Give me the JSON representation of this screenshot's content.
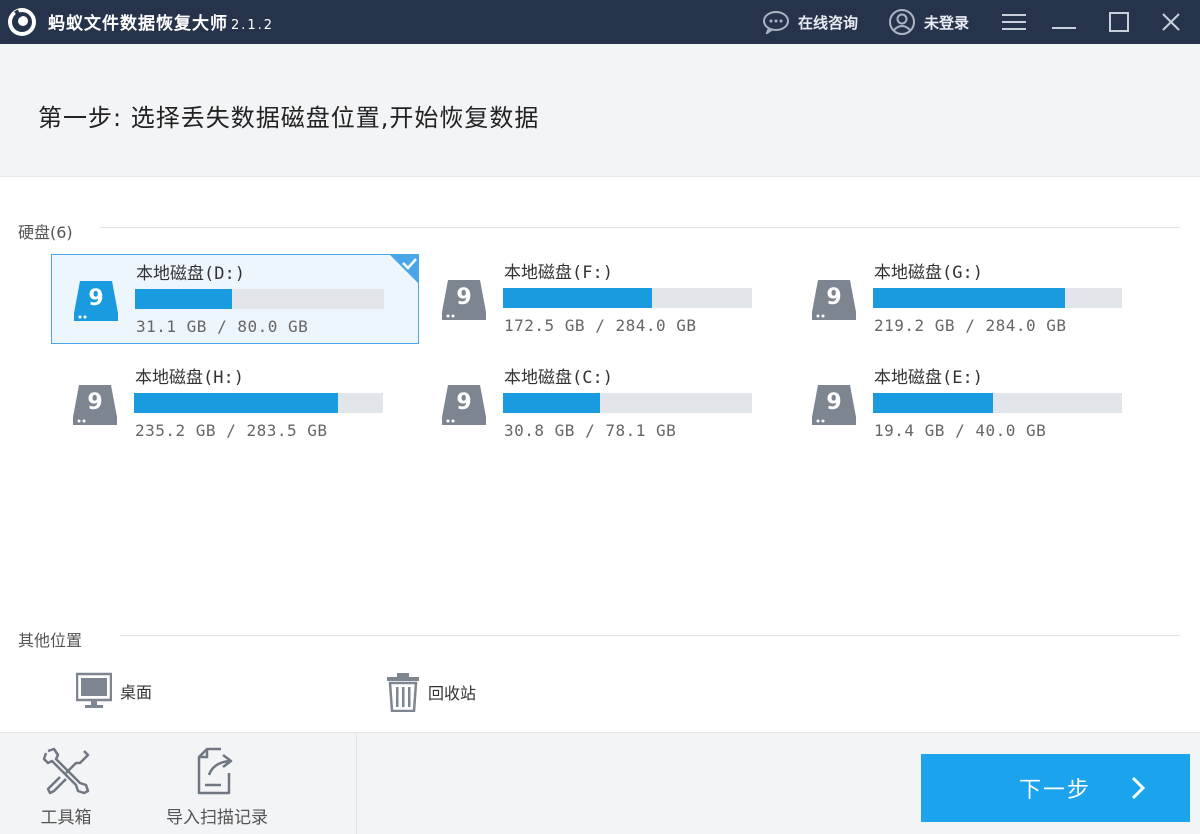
{
  "app": {
    "title": "蚂蚁文件数据恢复大师",
    "version": "2.1.2",
    "online_consult": "在线咨询",
    "login": "未登录"
  },
  "header": {
    "step_title": "第一步: 选择丢失数据磁盘位置,开始恢复数据"
  },
  "disks_section": {
    "label": "硬盘(6)",
    "disks": [
      {
        "name": "本地磁盘(D:)",
        "size": "31.1 GB / 80.0 GB",
        "used_fraction": 0.39,
        "selected": true
      },
      {
        "name": "本地磁盘(F:)",
        "size": "172.5 GB / 284.0 GB",
        "used_fraction": 0.6,
        "selected": false
      },
      {
        "name": "本地磁盘(G:)",
        "size": "219.2 GB / 284.0 GB",
        "used_fraction": 0.77,
        "selected": false
      },
      {
        "name": "本地磁盘(H:)",
        "size": "235.2 GB / 283.5 GB",
        "used_fraction": 0.82,
        "selected": false
      },
      {
        "name": "本地磁盘(C:)",
        "size": "30.8 GB / 78.1 GB",
        "used_fraction": 0.39,
        "selected": false
      },
      {
        "name": "本地磁盘(E:)",
        "size": "19.4 GB / 40.0 GB",
        "used_fraction": 0.48,
        "selected": false
      }
    ]
  },
  "other_section": {
    "label": "其他位置",
    "desktop": "桌面",
    "recycle_bin": "回收站"
  },
  "bottom": {
    "toolbox": "工具箱",
    "import_scan": "导入扫描记录",
    "next": "下一步"
  },
  "colors": {
    "titlebar": "#26344b",
    "accent": "#1ba3ee",
    "bar_fill": "#1a9be0",
    "bar_track": "#e2e5ea"
  },
  "icons": [
    "logo-icon",
    "chat-icon",
    "user-icon",
    "menu-icon",
    "minimize-icon",
    "maximize-icon",
    "close-icon",
    "disk-icon",
    "checkmark-icon",
    "monitor-icon",
    "trash-icon",
    "tools-icon",
    "import-icon",
    "chevron-right-icon"
  ]
}
